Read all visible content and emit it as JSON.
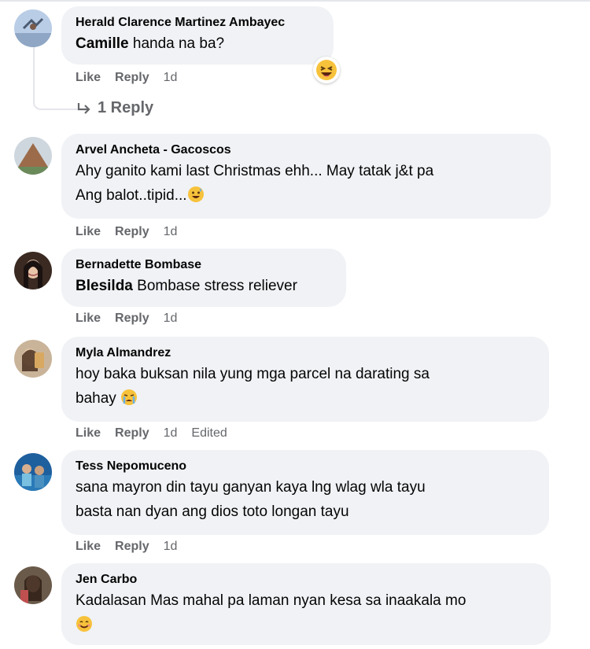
{
  "comments": [
    {
      "author": "Herald Clarence Martinez Ambayec",
      "mention": "Camille",
      "text": "handa na ba?",
      "actions": {
        "like": "Like",
        "reply": "Reply",
        "time": "1d"
      },
      "reaction": "laughing-emoji",
      "replies_label": "1 Reply"
    },
    {
      "author": "Arvel Ancheta - Gacoscos",
      "text_line1": "Ahy ganito kami last Christmas ehh... May tatak j&t pa",
      "text_line2": "Ang balot..tipid...",
      "actions": {
        "like": "Like",
        "reply": "Reply",
        "time": "1d"
      }
    },
    {
      "author": "Bernadette Bombase",
      "mention": "Blesilda",
      "text": "Bombase stress reliever",
      "actions": {
        "like": "Like",
        "reply": "Reply",
        "time": "1d"
      }
    },
    {
      "author": "Myla Almandrez",
      "text_line1": "hoy baka buksan nila yung mga parcel na darating sa",
      "text_line2": "bahay",
      "actions": {
        "like": "Like",
        "reply": "Reply",
        "time": "1d",
        "edited": "Edited"
      }
    },
    {
      "author": "Tess Nepomuceno",
      "text_line1": "sana mayron din tayu ganyan kaya lng wlag wla tayu",
      "text_line2": "basta nan dyan ang dios toto longan tayu",
      "actions": {
        "like": "Like",
        "reply": "Reply",
        "time": "1d"
      }
    },
    {
      "author": "Jen Carbo",
      "text_line1": "Kadalasan Mas mahal pa laman nyan kesa sa inaakala mo",
      "actions": {}
    }
  ],
  "colors": {
    "bubble": "#f0f2f5",
    "meta": "#65676b",
    "text": "#050505"
  }
}
